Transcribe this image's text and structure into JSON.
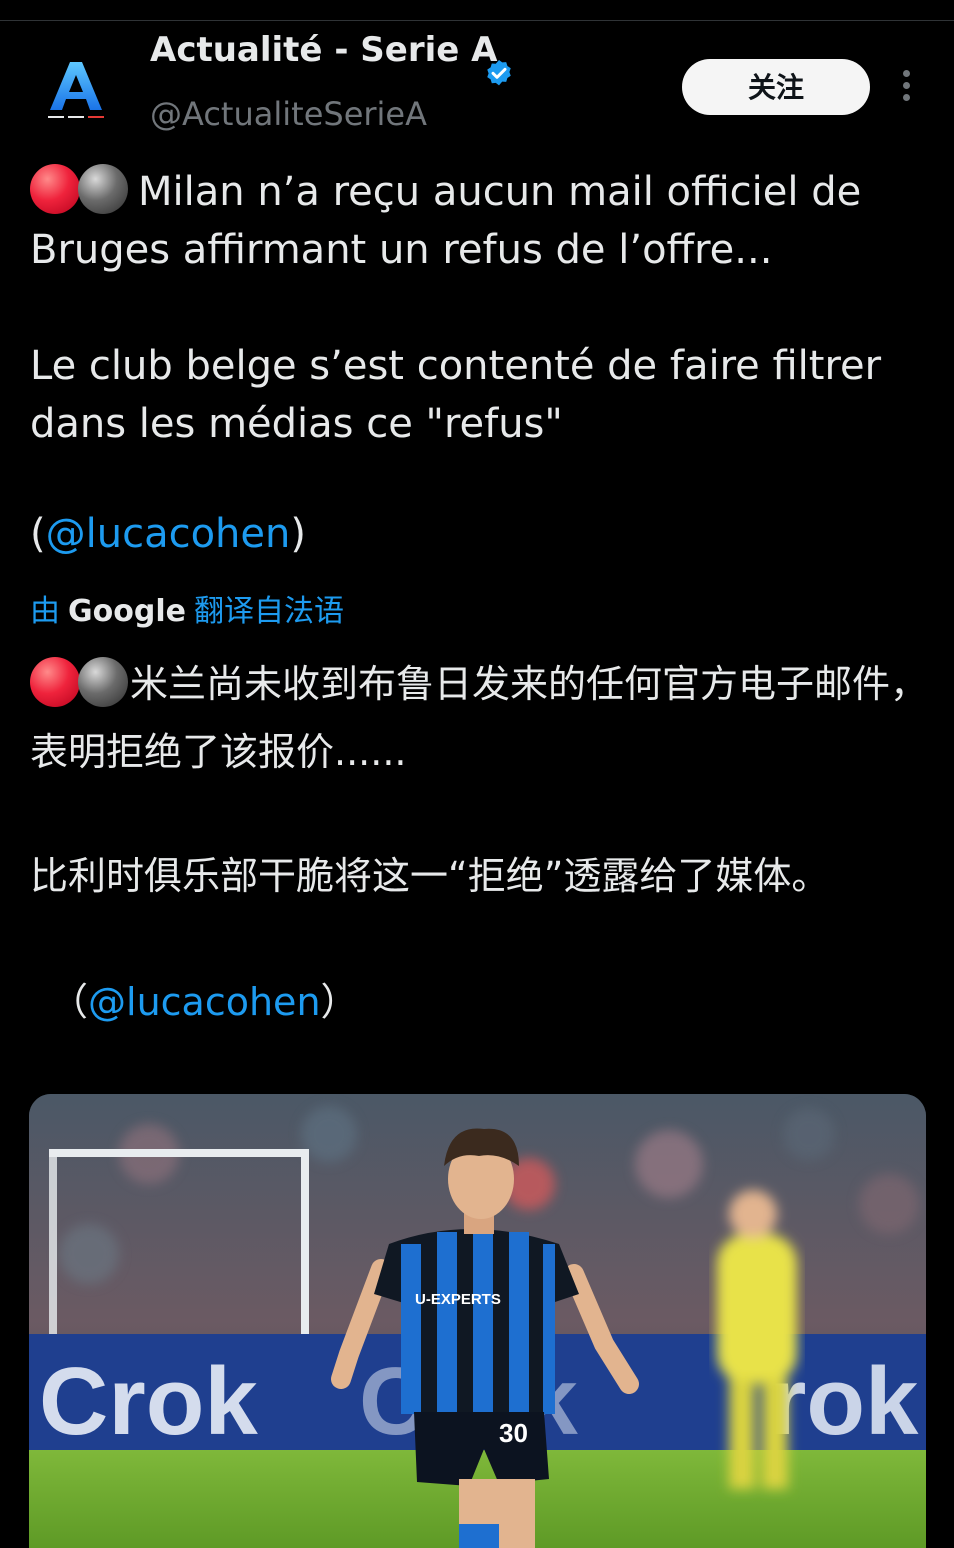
{
  "account": {
    "display_name": "Actualité - Serie A",
    "handle": "@ActualiteSerieA",
    "avatar_letter": "A",
    "verified": true
  },
  "actions": {
    "follow_label": "关注",
    "more_icon": "more-vertical-icon"
  },
  "tweet": {
    "line1": "Milan n’a reçu aucun mail officiel de Bruges affirmant un refus de l’offre...",
    "line2": "Le club belge s’est contenté de faire filtrer dans les médias ce \"refus\"",
    "mention_open": "(",
    "mention": "@lucacohen",
    "mention_close": ")"
  },
  "translation": {
    "by": "由",
    "provider": "Google",
    "link": "翻译自法语",
    "line1": "米兰尚未收到布鲁日发来的任何官方电子邮件，表明拒绝了该报价......",
    "line2": "比利时俱乐部干脆将这一“拒绝”透露给了媒体。",
    "mention_open": "（",
    "mention": "@lucacohen",
    "mention_close": "）"
  },
  "media": {
    "jersey_sponsor": "U-EXPERTS",
    "jersey_number": "30",
    "board_text": "Crok"
  },
  "colors": {
    "background": "#000000",
    "text": "#e7e9ea",
    "secondary": "#71767b",
    "link": "#1d9bf0",
    "verified": "#1d9bf0"
  }
}
